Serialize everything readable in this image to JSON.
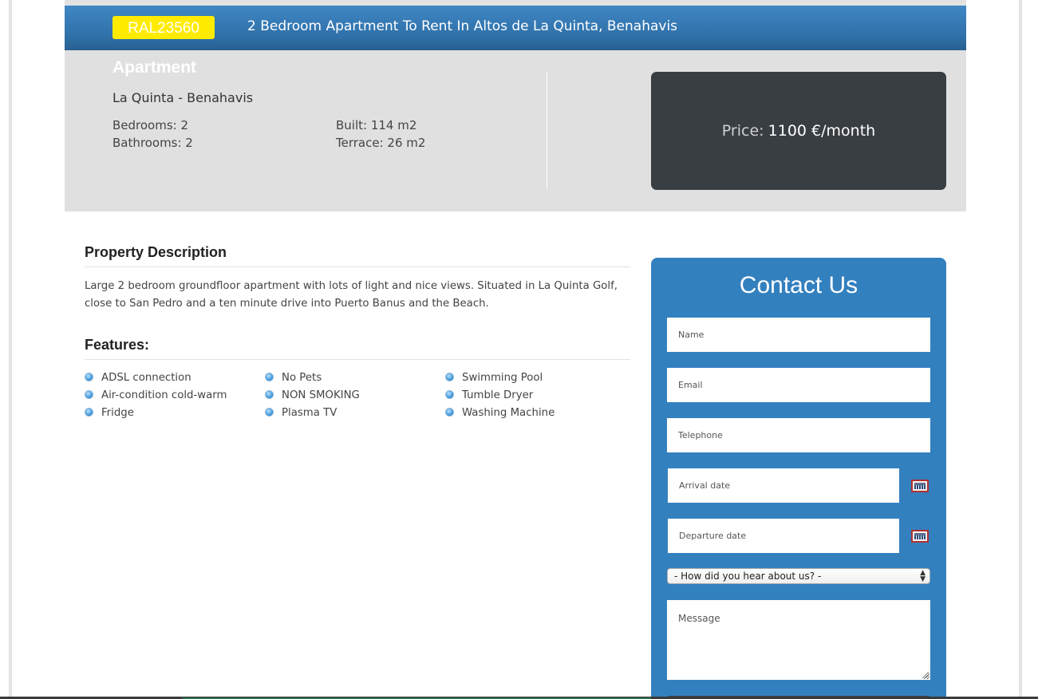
{
  "listing": {
    "reference": "RAL23560",
    "title": "2 Bedroom Apartment To Rent In Altos de La Quinta, Benahavis",
    "type": "Apartment",
    "location": "La Quinta - Benahavis",
    "specs": {
      "bedrooms": "Bedrooms: 2",
      "bathrooms": "Bathrooms: 2",
      "built": "Built: 114 m2",
      "terrace": "Terrace: 26  m2"
    },
    "price_label": "Price:",
    "price_value": "1100 €/month"
  },
  "description": {
    "heading": "Property Description",
    "text": "Large 2 bedroom groundfloor apartment with lots of light and nice views. Situated in La Quinta Golf, close to San Pedro and a ten minute drive into Puerto Banus and the Beach."
  },
  "features": {
    "heading": "Features:",
    "bullet_icon": "blue-globe-bullet-icon",
    "items": [
      "ADSL connection",
      "No Pets",
      "Swimming Pool",
      "Air-condition cold-warm",
      "NON SMOKING",
      "Tumble Dryer",
      "Fridge",
      "Plasma TV",
      "Washing Machine"
    ]
  },
  "contact": {
    "title": "Contact Us",
    "name_placeholder": "Name",
    "email_placeholder": "Email",
    "telephone_placeholder": "Telephone",
    "arrival_placeholder": "Arrival date",
    "departure_placeholder": "Departure date",
    "calendar_icon": "calendar-icon",
    "heard_about_selected": "- How did you hear about us? -",
    "message_placeholder": "Message"
  },
  "colors": {
    "title_bar": "#3380bf",
    "badge": "#ffeb00",
    "price_box": "#393e43",
    "contact_panel": "#3380bf",
    "summary_bg": "#e0e0e0"
  }
}
